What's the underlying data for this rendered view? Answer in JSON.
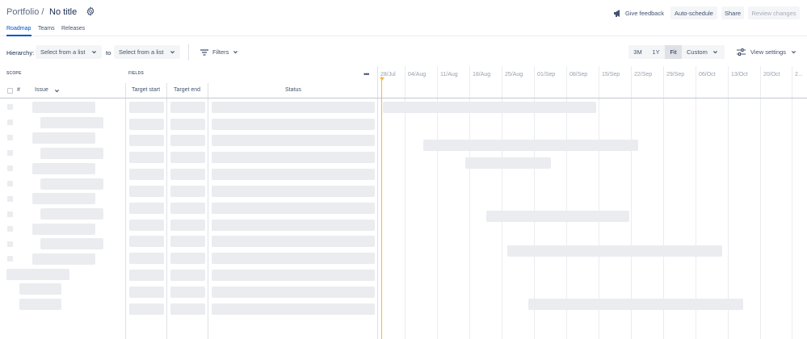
{
  "header": {
    "crumb": "Portfolio /",
    "title": "No title",
    "feedback_label": "Give feedback",
    "autoschedule_label": "Auto-schedule",
    "share_label": "Share",
    "review_label": "Review changes"
  },
  "tabs": [
    {
      "label": "Roadmap",
      "active": true
    },
    {
      "label": "Teams",
      "active": false
    },
    {
      "label": "Releases",
      "active": false
    }
  ],
  "toolbar": {
    "hierarchy_label": "Hierarchy:",
    "from_select": "Select from a list",
    "to_label": "to",
    "to_select": "Select from a list",
    "filters_label": "Filters",
    "range_3m": "3M",
    "range_1y": "1Y",
    "range_fit": "Fit",
    "range_custom": "Custom",
    "view_settings": "View settings"
  },
  "table": {
    "scope_label": "SCOPE",
    "fields_label": "FIELDS",
    "hash_label": "#",
    "issue_label": "Issue",
    "target_start": "Target start",
    "target_end": "Target end",
    "status": "Status"
  },
  "timeline": {
    "dates": [
      "28/Jul",
      "04/Aug",
      "11/Aug",
      "18/Aug",
      "25/Aug",
      "01/Sep",
      "08/Sep",
      "15/Sep",
      "22/Sep",
      "29/Sep",
      "06/Oct",
      "13/Oct",
      "20/Oct",
      "2..."
    ]
  },
  "colors": {
    "accent": "#0052cc",
    "today_marker": "#f4b642",
    "skeleton": "#ebecf0"
  }
}
